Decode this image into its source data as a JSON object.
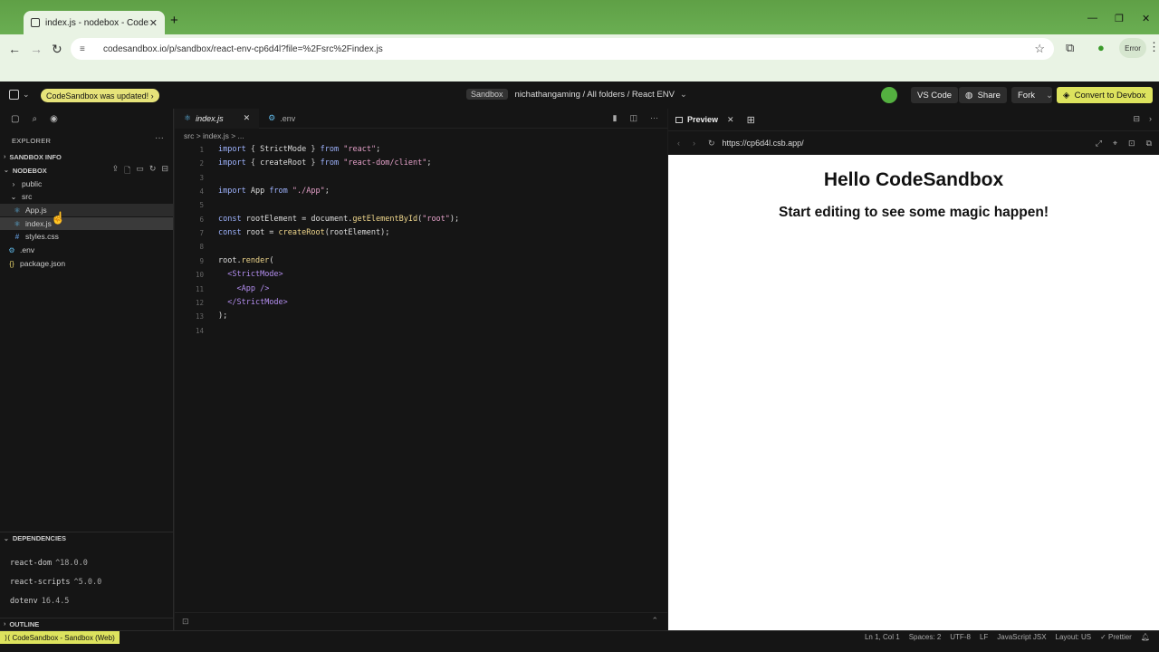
{
  "browser": {
    "tab_title": "index.js - nodebox - CodeSandbox",
    "url": "codesandbox.io/p/sandbox/react-env-cp6d4l?file=%2Fsrc%2Findex.js",
    "error_label": "Error"
  },
  "header": {
    "update_badge": "CodeSandbox was updated!",
    "sandbox_chip": "Sandbox",
    "breadcrumb": "nichathangaming / All folders / React ENV",
    "vscode_label": "VS Code",
    "share_label": "Share",
    "fork_label": "Fork",
    "convert_label": "Convert to Devbox"
  },
  "sidebar": {
    "title": "EXPLORER",
    "sandbox_info": "SANDBOX INFO",
    "project": "NODEBOX",
    "files": [
      {
        "name": "public",
        "icon": "chevron-right-icon"
      },
      {
        "name": "src",
        "icon": "chevron-down-icon"
      },
      {
        "name": "App.js",
        "icon": "react-icon"
      },
      {
        "name": "index.js",
        "icon": "react-icon"
      },
      {
        "name": "styles.css",
        "icon": "css-icon"
      },
      {
        "name": ".env",
        "icon": "gear-icon"
      },
      {
        "name": "package.json",
        "icon": "json-icon"
      }
    ],
    "dependencies_title": "DEPENDENCIES",
    "dependencies": [
      {
        "name": "react-dom",
        "version": "^18.0.0"
      },
      {
        "name": "react-scripts",
        "version": "^5.0.0"
      },
      {
        "name": "dotenv",
        "version": "16.4.5"
      }
    ],
    "outline_title": "OUTLINE"
  },
  "editor": {
    "tabs": [
      {
        "label": "index.js",
        "active": true
      },
      {
        "label": ".env",
        "active": false
      }
    ],
    "breadcrumb": "src  >  index.js  >  ...",
    "line_numbers": [
      "1",
      "2",
      "3",
      "4",
      "5",
      "6",
      "7",
      "8",
      "9",
      "10",
      "11",
      "12",
      "13",
      "14"
    ]
  },
  "preview": {
    "tab_label": "Preview",
    "url": "https://cp6d4l.csb.app/",
    "heading": "Hello CodeSandbox",
    "subheading": "Start editing to see some magic happen!"
  },
  "statusbar": {
    "left": "CodeSandbox - Sandbox (Web)",
    "position": "Ln 1, Col 1",
    "spaces": "Spaces: 2",
    "encoding": "UTF-8",
    "eol": "LF",
    "language": "JavaScript JSX",
    "layout": "Layout: US",
    "formatter": "Prettier"
  },
  "colors": {
    "accent": "#dde35e",
    "browser_green": "#6aae52"
  }
}
